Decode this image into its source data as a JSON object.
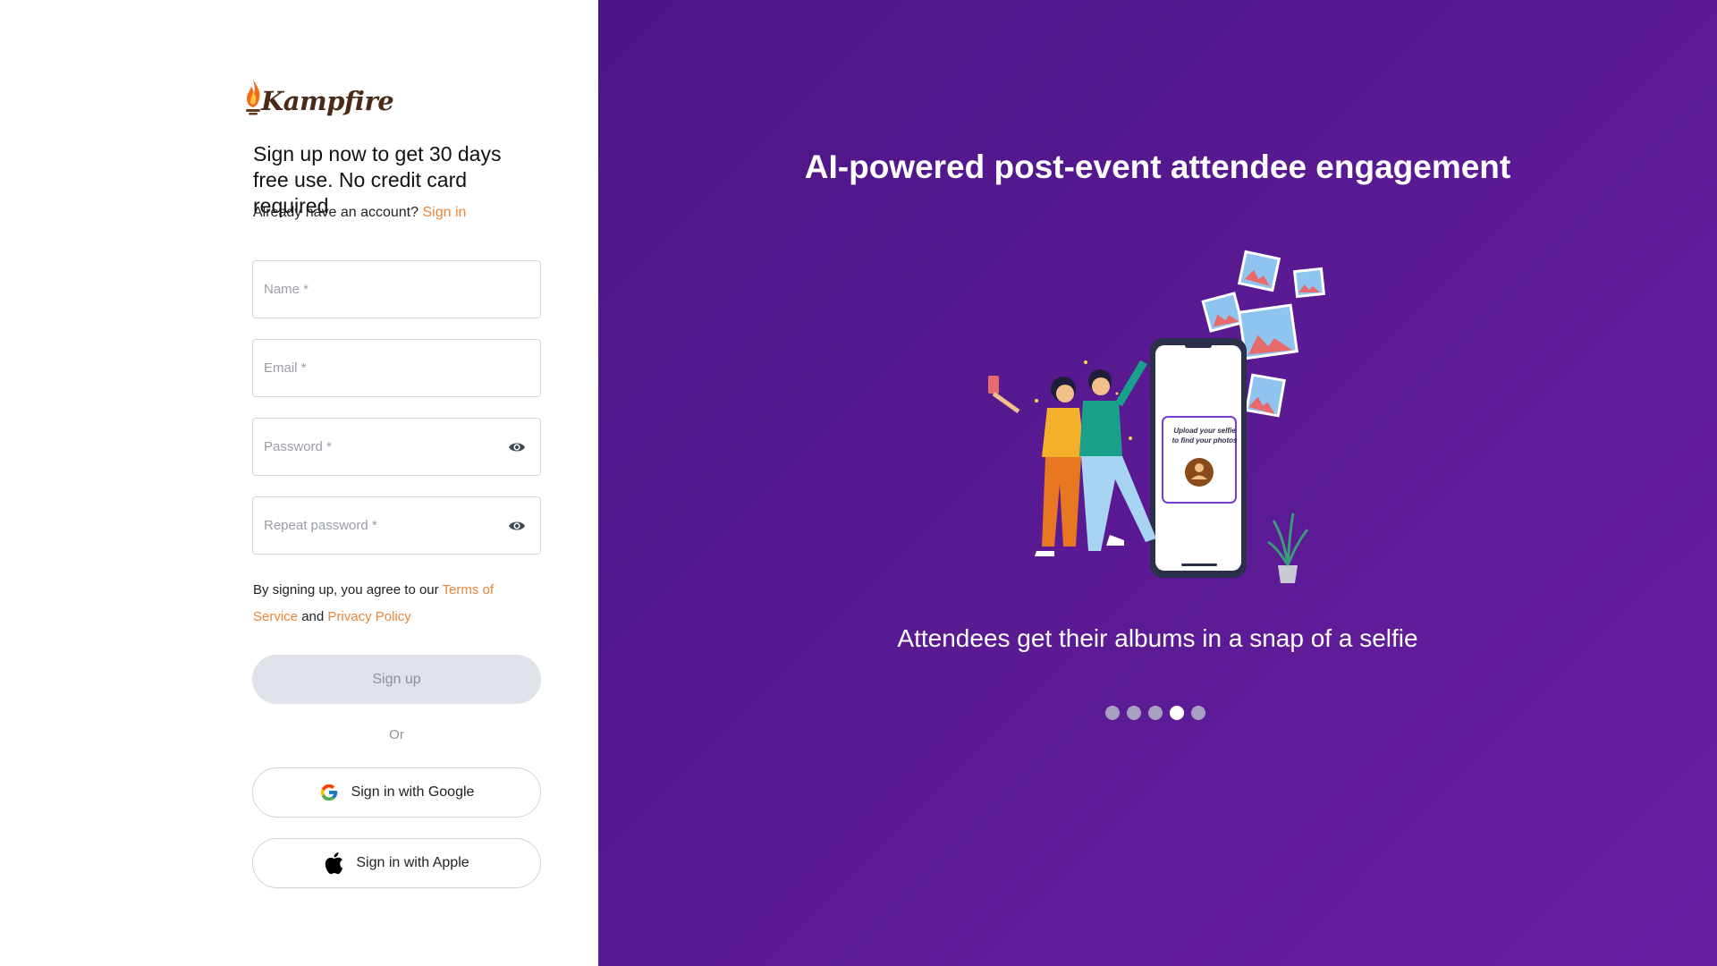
{
  "brand": {
    "name": "Kampfire",
    "accent_color": "#e8863a",
    "panel_color": "#5a1a93"
  },
  "signup": {
    "headline": "Sign up now to get 30 days free use. No credit card required",
    "account_prompt": "Already have an account?",
    "sign_in_link": "Sign in",
    "fields": {
      "name_placeholder": "Name *",
      "email_placeholder": "Email *",
      "password_placeholder": "Password *",
      "repeat_password_placeholder": "Repeat password *"
    },
    "terms_prefix": "By signing up, you agree to our",
    "terms_link": "Terms of Service",
    "terms_and": "and",
    "privacy_link": "Privacy Policy",
    "signup_button": "Sign up",
    "or_label": "Or",
    "google_button": "Sign in with Google",
    "apple_button": "Sign in with Apple"
  },
  "hero": {
    "title": "AI-powered post-event attendee engagement",
    "phone_text": "Upload your selfie to find your photos",
    "caption": "Attendees get their albums in a snap of a selfie",
    "carousel": {
      "slide_count": 5,
      "active_index": 3
    }
  },
  "icons": {
    "logo": "flame-icon",
    "password_toggle": "eye-icon",
    "google": "google-icon",
    "apple": "apple-icon"
  }
}
